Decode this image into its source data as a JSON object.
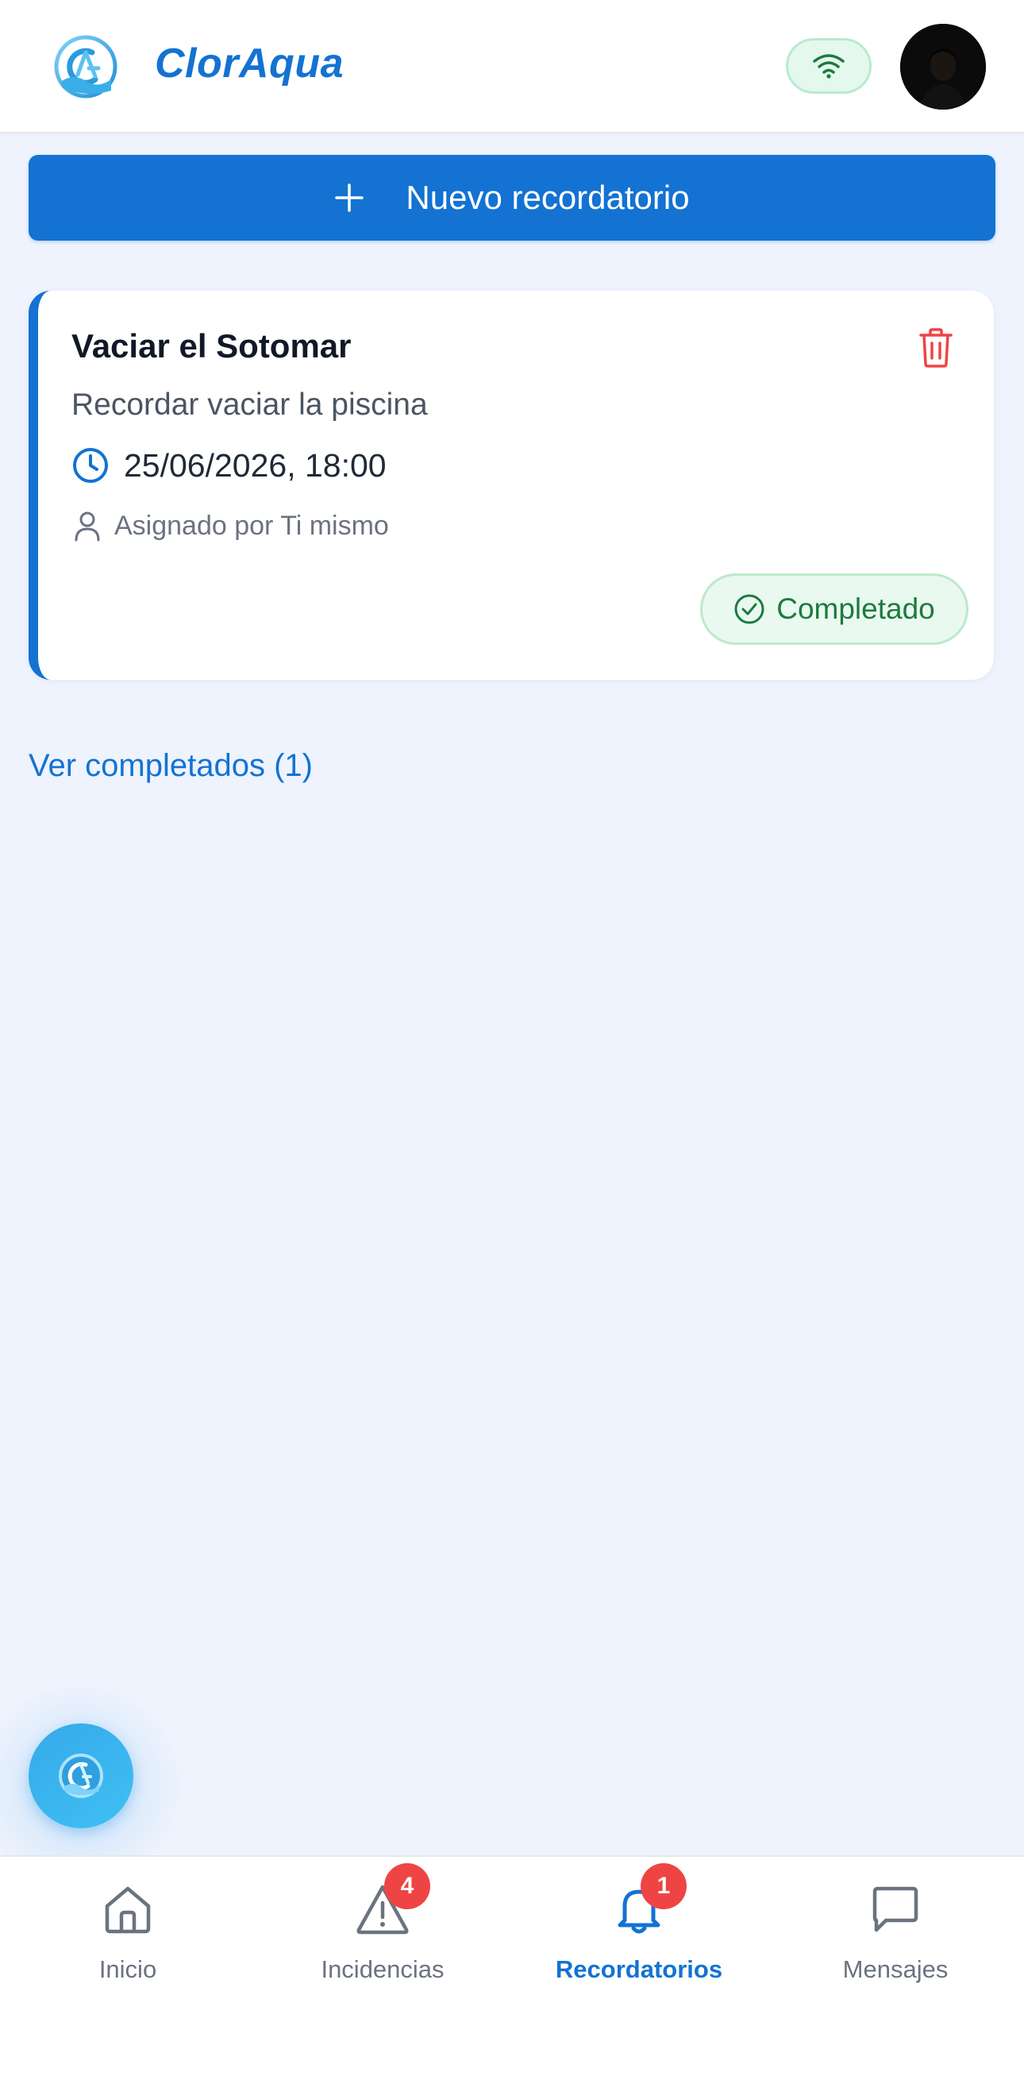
{
  "header": {
    "app_title": "ClorAqua",
    "logo_icon": "cloraqua-logo-icon",
    "status_icon": "wifi-icon",
    "avatar_icon": "avatar"
  },
  "actions": {
    "new_reminder_label": "Nuevo recordatorio"
  },
  "reminders": [
    {
      "title": "Vaciar el Sotomar",
      "description": "Recordar vaciar la piscina",
      "datetime": "25/06/2026, 18:00",
      "assigned": "Asignado por Ti mismo",
      "status": "Completado"
    }
  ],
  "links": {
    "view_completed": "Ver completados (1)"
  },
  "bottom_nav": {
    "items": [
      {
        "label": "Inicio",
        "icon": "home-icon",
        "badge": null,
        "active": false
      },
      {
        "label": "Incidencias",
        "icon": "warning-icon",
        "badge": "4",
        "active": false
      },
      {
        "label": "Recordatorios",
        "icon": "bell-icon",
        "badge": "1",
        "active": true
      },
      {
        "label": "Mensajes",
        "icon": "message-icon",
        "badge": null,
        "active": false
      }
    ]
  },
  "colors": {
    "accent": "#1472d2",
    "background": "#eef3fd",
    "success": "#1d7a3f",
    "danger": "#ef4444"
  }
}
